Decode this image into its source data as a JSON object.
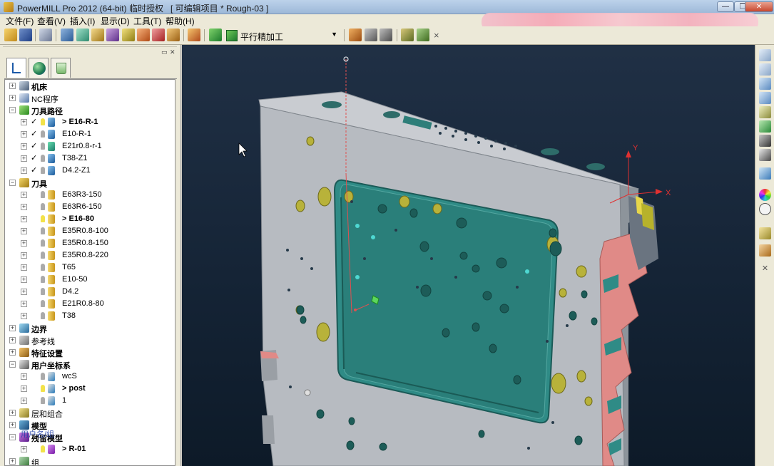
{
  "window": {
    "title": "PowerMILL Pro 2012 (64-bit) 临时授权   [ 可编辑项目 * Rough-03 ]",
    "min_label": "—",
    "max_label": "❐",
    "close_label": "✕"
  },
  "menu": [
    "文件(F)",
    "查看(V)",
    "插入(I)",
    "显示(D)",
    "工具(T)",
    "帮助(H)"
  ],
  "toolbar": {
    "strategy_label": "平行精加工",
    "close_label": "×"
  },
  "explorer": {
    "tabs": [
      "explorer-tab",
      "globe-tab",
      "recycle-tab"
    ],
    "tree": [
      {
        "label": "机床",
        "level": 0,
        "bold": true
      },
      {
        "label": "NC程序",
        "level": 0,
        "bold": false
      },
      {
        "label": "刀具路径",
        "level": 0,
        "bold": true,
        "expanded": true
      },
      {
        "label": "> E16-R-1",
        "level": 1,
        "bold": true,
        "checked": true,
        "active": true
      },
      {
        "label": "E10-R-1",
        "level": 1,
        "bold": false,
        "checked": true
      },
      {
        "label": "E21r0.8-r-1",
        "level": 1,
        "bold": false,
        "checked": true
      },
      {
        "label": "T38-Z1",
        "level": 1,
        "bold": false,
        "checked": true
      },
      {
        "label": "D4.2-Z1",
        "level": 1,
        "bold": false,
        "checked": true
      },
      {
        "label": "刀具",
        "level": 0,
        "bold": true,
        "expanded": true
      },
      {
        "label": "E63R3-150",
        "level": 1,
        "bold": false
      },
      {
        "label": "E63R6-150",
        "level": 1,
        "bold": false
      },
      {
        "label": "> E16-80",
        "level": 1,
        "bold": true,
        "active": true
      },
      {
        "label": "E35R0.8-100",
        "level": 1,
        "bold": false
      },
      {
        "label": "E35R0.8-150",
        "level": 1,
        "bold": false
      },
      {
        "label": "E35R0.8-220",
        "level": 1,
        "bold": false
      },
      {
        "label": "T65",
        "level": 1,
        "bold": false
      },
      {
        "label": "E10-50",
        "level": 1,
        "bold": false
      },
      {
        "label": "D4.2",
        "level": 1,
        "bold": false
      },
      {
        "label": "E21R0.8-80",
        "level": 1,
        "bold": false
      },
      {
        "label": "T38",
        "level": 1,
        "bold": false
      },
      {
        "label": "边界",
        "level": 0,
        "bold": true
      },
      {
        "label": "参考线",
        "level": 0,
        "bold": false
      },
      {
        "label": "特征设置",
        "level": 0,
        "bold": true
      },
      {
        "label": "用户坐标系",
        "level": 0,
        "bold": true,
        "expanded": true
      },
      {
        "label": "wcS",
        "level": 1,
        "bold": false
      },
      {
        "label": "> post",
        "level": 1,
        "bold": true,
        "active": true
      },
      {
        "label": "1",
        "level": 1,
        "bold": false
      },
      {
        "label": "层和组合",
        "level": 0,
        "bold": false
      },
      {
        "label": "模型",
        "level": 0,
        "bold": true
      },
      {
        "label": "残留模型",
        "level": 0,
        "bold": true,
        "expanded": true
      },
      {
        "label": "> R-01",
        "level": 1,
        "bold": true,
        "active": true
      },
      {
        "label": "组",
        "level": 0,
        "bold": false
      }
    ],
    "overlay_text": "用户名/组"
  },
  "viewport": {
    "axis_x": "X",
    "axis_y": "Y"
  },
  "colors": {
    "part_gray": "#b9bdc3",
    "pocket_teal": "#2f8b86",
    "viewport_bg": "#17283b",
    "cut_pink": "#e08a87"
  }
}
